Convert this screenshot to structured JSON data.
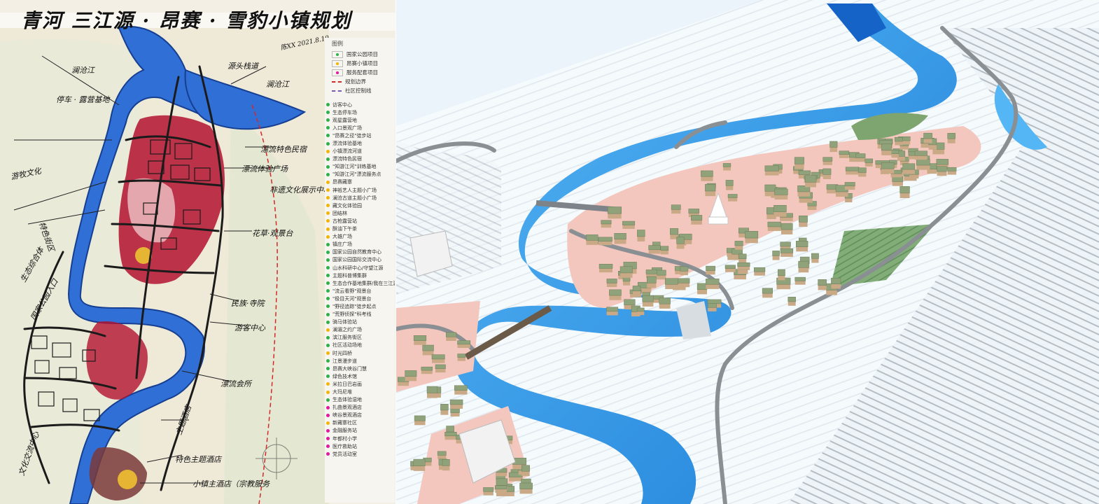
{
  "sketch": {
    "title": "青河 三江源 · 昂赛 · 雪豹小镇规划",
    "signature": "陈XX 2021.8.10",
    "annotations": [
      "澜沧江",
      "源头栈道",
      "澜沧江",
      "停车 · 露营基地",
      "漂流特色民宿",
      "漂流体验广场",
      "非遗文化展示中心",
      "游牧文化",
      "特色街区",
      "花草·观景台",
      "民族·寺院",
      "国家公园入口",
      "生态综合体",
      "游客中心",
      "漂流会所",
      "主题酒店",
      "特色主题酒店",
      "小镇主酒店（宗教服务",
      "文化交流中心"
    ],
    "colors": {
      "river": "#2f6fd6",
      "core": "#b3122f",
      "road": "#1b1b1b",
      "land": "#efe9d8",
      "green": "#d9e6cf"
    }
  },
  "legend": {
    "title": "图例",
    "header_items": [
      {
        "label": "国家公园项目",
        "color": "#2db24a"
      },
      {
        "label": "昂赛小镇项目",
        "color": "#f2b600"
      },
      {
        "label": "服务配套项目",
        "color": "#e2189e"
      },
      {
        "label": "规划边界",
        "color": "#d22a2a"
      },
      {
        "label": "社区控制线",
        "color": "#7b5bb0"
      }
    ],
    "items": [
      {
        "label": "访客中心",
        "color": "#2db24a"
      },
      {
        "label": "生态停车场",
        "color": "#2db24a"
      },
      {
        "label": "观星露营地",
        "color": "#2db24a"
      },
      {
        "label": "入口景观广场",
        "color": "#2db24a"
      },
      {
        "label": "\"昂赛之径\"徒步站",
        "color": "#2db24a"
      },
      {
        "label": "漂流体验基地",
        "color": "#2db24a"
      },
      {
        "label": "小镇漂流河道",
        "color": "#f2b600"
      },
      {
        "label": "漂流特色民宿",
        "color": "#2db24a"
      },
      {
        "label": "\"知游江河\"训练基地",
        "color": "#2db24a"
      },
      {
        "label": "\"知游江河\"漂流服务点",
        "color": "#2db24a"
      },
      {
        "label": "昂赛藏寨",
        "color": "#f2b600"
      },
      {
        "label": "神祇艺人主题小广场",
        "color": "#f2b600"
      },
      {
        "label": "澜沧古道主题小广场",
        "color": "#f2b600"
      },
      {
        "label": "藏文化体验园",
        "color": "#f2b600"
      },
      {
        "label": "团结林",
        "color": "#f2b600"
      },
      {
        "label": "古枪露营站",
        "color": "#f2b600"
      },
      {
        "label": "酥油下午茶",
        "color": "#f2b600"
      },
      {
        "label": "大雄广场",
        "color": "#f2b600"
      },
      {
        "label": "镇庄广场",
        "color": "#2db24a"
      },
      {
        "label": "国家公园自然教育中心",
        "color": "#2db24a"
      },
      {
        "label": "国家公园国际交流中心",
        "color": "#2db24a"
      },
      {
        "label": "山水科研中心/守望江源",
        "color": "#2db24a"
      },
      {
        "label": "主题科普博集群",
        "color": "#2db24a"
      },
      {
        "label": "生态合作基地集群/我在三江源",
        "color": "#2db24a"
      },
      {
        "label": "\"流云看野\"观景台",
        "color": "#2db24a"
      },
      {
        "label": "\"极目天河\"观景台",
        "color": "#2db24a"
      },
      {
        "label": "\"野径追踪\"徒步起点",
        "color": "#2db24a"
      },
      {
        "label": "\"荒野侦探\"科考线",
        "color": "#2db24a"
      },
      {
        "label": "骑马体验站",
        "color": "#2db24a"
      },
      {
        "label": "澜湄之约广场",
        "color": "#f2b600"
      },
      {
        "label": "滨江服务街区",
        "color": "#2db24a"
      },
      {
        "label": "社区活动场地",
        "color": "#2db24a"
      },
      {
        "label": "时光四桥",
        "color": "#f2b600"
      },
      {
        "label": "江景漫步道",
        "color": "#2db24a"
      },
      {
        "label": "昂赛大峡谷门慧",
        "color": "#2db24a"
      },
      {
        "label": "绿色技术馆",
        "color": "#2db24a"
      },
      {
        "label": "米拉日巴岩画",
        "color": "#f2b600"
      },
      {
        "label": "大玛尼堆",
        "color": "#f2b600"
      },
      {
        "label": "生态体验湿地",
        "color": "#2db24a"
      },
      {
        "label": "扎曲景观酒店",
        "color": "#e2189e"
      },
      {
        "label": "峡谷景观酒店",
        "color": "#e2189e"
      },
      {
        "label": "新藏寨社区",
        "color": "#f2b600"
      },
      {
        "label": "金融服务站",
        "color": "#e2189e"
      },
      {
        "label": "年都村小学",
        "color": "#e2189e"
      },
      {
        "label": "医疗救助站",
        "color": "#e2189e"
      },
      {
        "label": "党员活动室",
        "color": "#e2189e"
      }
    ]
  },
  "model": {
    "colors": {
      "sky": "#eaf4fa",
      "terrain": "#f5fafd",
      "river": "#2a8fe4",
      "river_light": "#55b6f5",
      "road": "#8a8f94",
      "plaza": "#f3c7bd",
      "roof_green": "#8fa27a",
      "wall": "#c9a986",
      "field": "#6f9e6a"
    }
  }
}
